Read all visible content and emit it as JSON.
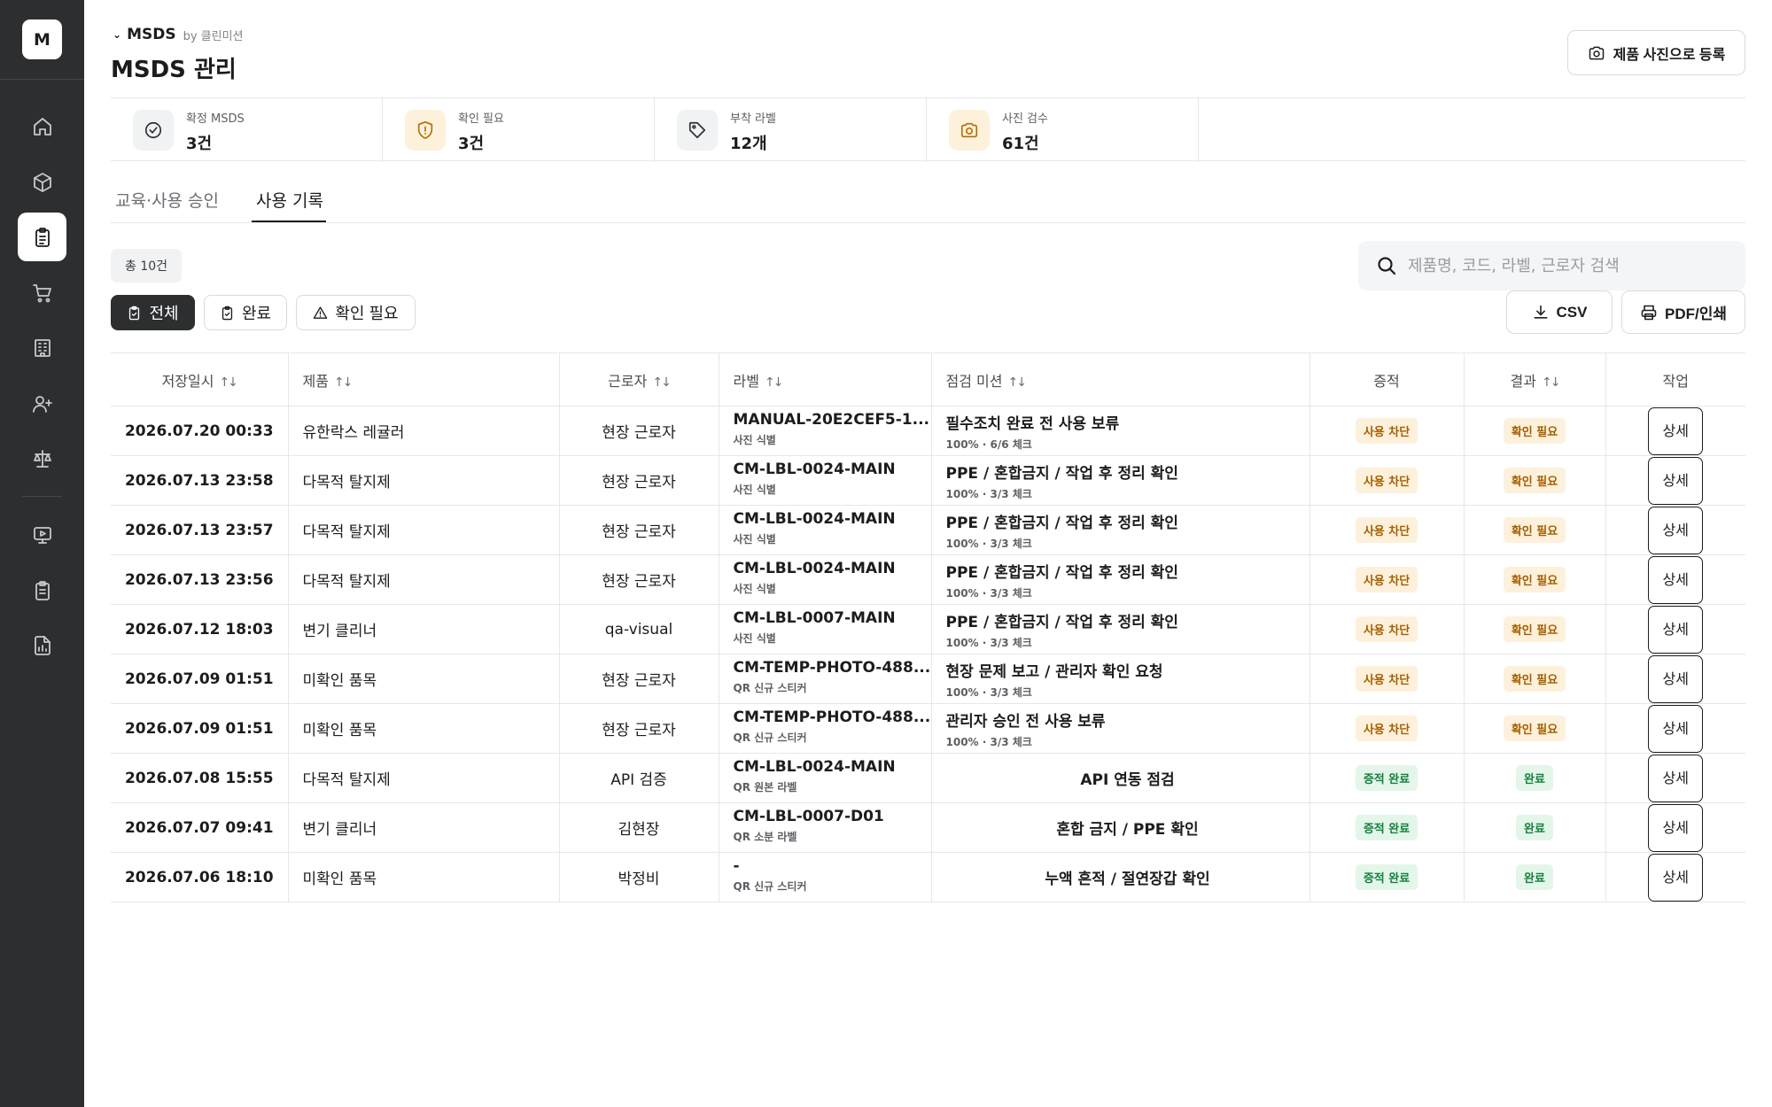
{
  "sidebar": {
    "logo": "M",
    "items": [
      {
        "icon": "home-icon"
      },
      {
        "icon": "cube-icon"
      },
      {
        "icon": "clipboard-icon",
        "active": true
      },
      {
        "icon": "cart-icon"
      },
      {
        "icon": "building-icon"
      },
      {
        "icon": "user-plus-icon"
      },
      {
        "icon": "scale-icon"
      },
      {
        "icon": "monitor-icon"
      },
      {
        "icon": "clipboard-list-icon"
      },
      {
        "icon": "report-icon"
      }
    ]
  },
  "header": {
    "breadcrumb_title": "MSDS",
    "breadcrumb_by": "by 클린미션",
    "page_title": "MSDS 관리",
    "photo_button": "제품 사진으로 등록"
  },
  "stats": [
    {
      "label": "확정 MSDS",
      "value": "3건",
      "icon": "check-circle-icon"
    },
    {
      "label": "확인 필요",
      "value": "3건",
      "icon": "shield-alert-icon"
    },
    {
      "label": "부착 라벨",
      "value": "12개",
      "icon": "tag-icon"
    },
    {
      "label": "사진 검수",
      "value": "61건",
      "icon": "camera-icon"
    }
  ],
  "tabs": [
    {
      "label": "교육·사용 승인",
      "active": false
    },
    {
      "label": "사용 기록",
      "active": true
    }
  ],
  "filters": {
    "total": "총 10건",
    "segments": [
      {
        "label": "전체",
        "active": true
      },
      {
        "label": "완료",
        "active": false
      },
      {
        "label": "확인 필요",
        "active": false
      }
    ],
    "search_placeholder": "제품명, 코드, 라벨, 근로자 검색",
    "csv_label": "CSV",
    "pdf_label": "PDF/인쇄"
  },
  "table": {
    "columns": [
      "저장일시",
      "제품",
      "근로자",
      "라벨",
      "점검 미션",
      "증적",
      "결과",
      "작업"
    ],
    "rows": [
      {
        "date": "2026.07.20 00:33",
        "product": "유한락스 레귤러",
        "worker": "현장 근로자",
        "label": "MANUAL-20E2CEF5-1...",
        "label_sub": "사진 식별",
        "mission": "필수조치 완료 전 사용 보류",
        "mission_sub": "100% · 6/6 체크",
        "evidence": "사용 차단",
        "result": "확인 필요",
        "action": "상세"
      },
      {
        "date": "2026.07.13 23:58",
        "product": "다목적 탈지제",
        "worker": "현장 근로자",
        "label": "CM-LBL-0024-MAIN",
        "label_sub": "사진 식별",
        "mission": "PPE / 혼합금지 / 작업 후 정리 확인",
        "mission_sub": "100% · 3/3 체크",
        "evidence": "사용 차단",
        "result": "확인 필요",
        "action": "상세"
      },
      {
        "date": "2026.07.13 23:57",
        "product": "다목적 탈지제",
        "worker": "현장 근로자",
        "label": "CM-LBL-0024-MAIN",
        "label_sub": "사진 식별",
        "mission": "PPE / 혼합금지 / 작업 후 정리 확인",
        "mission_sub": "100% · 3/3 체크",
        "evidence": "사용 차단",
        "result": "확인 필요",
        "action": "상세"
      },
      {
        "date": "2026.07.13 23:56",
        "product": "다목적 탈지제",
        "worker": "현장 근로자",
        "label": "CM-LBL-0024-MAIN",
        "label_sub": "사진 식별",
        "mission": "PPE / 혼합금지 / 작업 후 정리 확인",
        "mission_sub": "100% · 3/3 체크",
        "evidence": "사용 차단",
        "result": "확인 필요",
        "action": "상세"
      },
      {
        "date": "2026.07.12 18:03",
        "product": "변기 클리너",
        "worker": "qa-visual",
        "label": "CM-LBL-0007-MAIN",
        "label_sub": "사진 식별",
        "mission": "PPE / 혼합금지 / 작업 후 정리 확인",
        "mission_sub": "100% · 3/3 체크",
        "evidence": "사용 차단",
        "result": "확인 필요",
        "action": "상세"
      },
      {
        "date": "2026.07.09 01:51",
        "product": "미확인 품목",
        "worker": "현장 근로자",
        "label": "CM-TEMP-PHOTO-488...",
        "label_sub": "QR 신규 스티커",
        "mission": "현장 문제 보고 / 관리자 확인 요청",
        "mission_sub": "100% · 3/3 체크",
        "evidence": "사용 차단",
        "result": "확인 필요",
        "action": "상세"
      },
      {
        "date": "2026.07.09 01:51",
        "product": "미확인 품목",
        "worker": "현장 근로자",
        "label": "CM-TEMP-PHOTO-488...",
        "label_sub": "QR 신규 스티커",
        "mission": "관리자 승인 전 사용 보류",
        "mission_sub": "100% · 3/3 체크",
        "evidence": "사용 차단",
        "result": "확인 필요",
        "action": "상세"
      },
      {
        "date": "2026.07.08 15:55",
        "product": "다목적 탈지제",
        "worker": "API 검증",
        "label": "CM-LBL-0024-MAIN",
        "label_sub": "QR 원본 라벨",
        "mission": "API 연동 점검",
        "mission_sub": "",
        "evidence": "증적 완료",
        "result": "완료",
        "action": "상세"
      },
      {
        "date": "2026.07.07 09:41",
        "product": "변기 클리너",
        "worker": "김현장",
        "label": "CM-LBL-0007-D01",
        "label_sub": "QR 소분 라벨",
        "mission": "혼합 금지 / PPE 확인",
        "mission_sub": "",
        "evidence": "증적 완료",
        "result": "완료",
        "action": "상세"
      },
      {
        "date": "2026.07.06 18:10",
        "product": "미확인 품목",
        "worker": "박정비",
        "label": "-",
        "label_sub": "QR 신규 스티커",
        "mission": "누액 흔적 / 절연장갑 확인",
        "mission_sub": "",
        "evidence": "증적 완료",
        "result": "완료",
        "action": "상세"
      }
    ]
  },
  "colors": {
    "sidebar_bg": "#2c2e30",
    "warn_bg": "#fdf1dc",
    "warn_text": "#a45f00",
    "ok_bg": "#e4f6ea",
    "ok_text": "#15803d"
  }
}
